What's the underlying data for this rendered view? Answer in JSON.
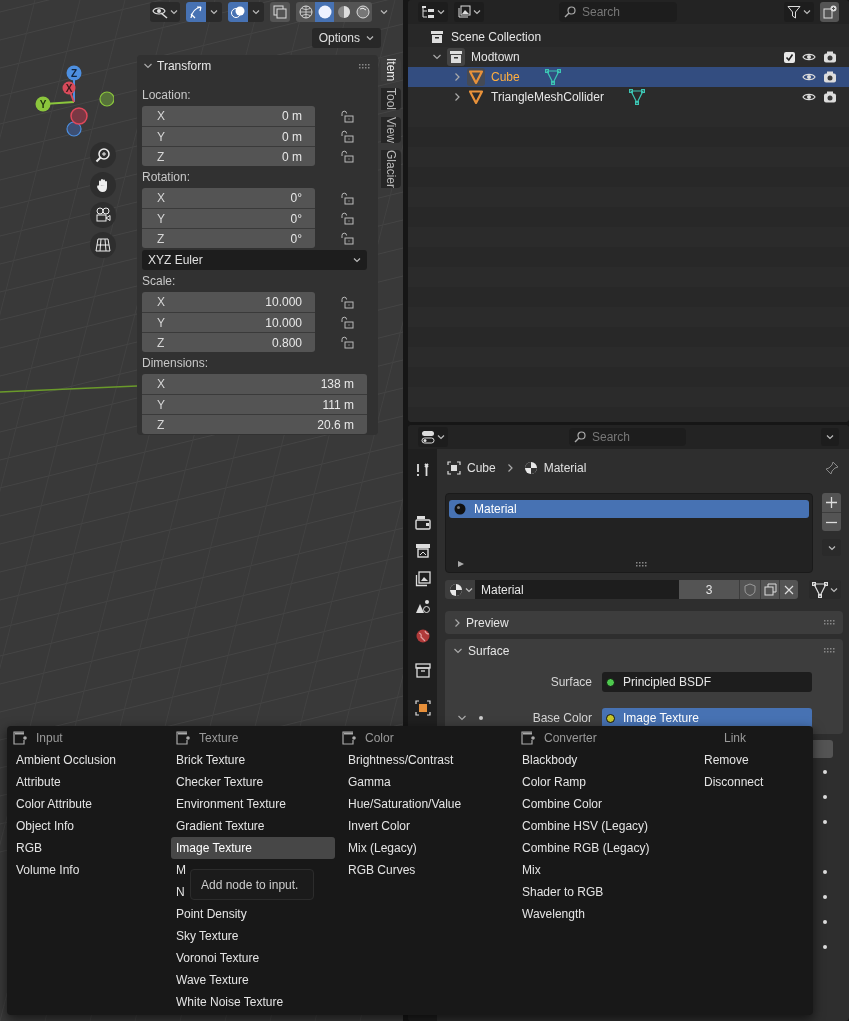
{
  "viewport": {
    "header": {
      "gizmos": true,
      "overlays": true,
      "xray": false,
      "shading": [
        {
          "kind": "wireframe",
          "selected": false
        },
        {
          "kind": "solid",
          "selected": true
        },
        {
          "kind": "material",
          "selected": false
        },
        {
          "kind": "rendered",
          "selected": false
        }
      ]
    },
    "options_button": "Options",
    "gizmo_axes": [
      "X",
      "Y",
      "Z"
    ],
    "sidebar": {
      "title": "Transform",
      "expanded": true,
      "groups": [
        {
          "kind": "vector",
          "label": "Location:",
          "lockable": true,
          "rows": [
            {
              "axis": "X",
              "value": "0 m"
            },
            {
              "axis": "Y",
              "value": "0 m"
            },
            {
              "axis": "Z",
              "value": "0 m"
            }
          ]
        },
        {
          "kind": "vector",
          "label": "Rotation:",
          "lockable": true,
          "rows": [
            {
              "axis": "X",
              "value": "0°"
            },
            {
              "axis": "Y",
              "value": "0°"
            },
            {
              "axis": "Z",
              "value": "0°"
            }
          ]
        },
        {
          "kind": "dropdown",
          "value": "XYZ Euler"
        },
        {
          "kind": "vector",
          "label": "Scale:",
          "lockable": true,
          "rows": [
            {
              "axis": "X",
              "value": "10.000"
            },
            {
              "axis": "Y",
              "value": "10.000"
            },
            {
              "axis": "Z",
              "value": "0.800"
            }
          ]
        },
        {
          "kind": "vector",
          "label": "Dimensions:",
          "lockable": false,
          "rows": [
            {
              "axis": "X",
              "value": "138 m"
            },
            {
              "axis": "Y",
              "value": "111 m"
            },
            {
              "axis": "Z",
              "value": "20.6 m"
            }
          ]
        }
      ]
    },
    "tabs": [
      {
        "label": "Item",
        "selected": true
      },
      {
        "label": "Tool",
        "selected": false
      },
      {
        "label": "View",
        "selected": false
      },
      {
        "label": "Glacier",
        "selected": false
      }
    ]
  },
  "outliner": {
    "search": {
      "placeholder": "Search"
    },
    "tree": [
      {
        "label": "Scene Collection",
        "kind": "scene",
        "selected": false,
        "children": [
          {
            "label": "Modtown",
            "kind": "collection",
            "expanded": true,
            "checked": true,
            "selected": false,
            "children": [
              {
                "label": "Cube",
                "kind": "object",
                "expanded": false,
                "selected": true
              },
              {
                "label": "TriangleMeshCollider",
                "kind": "object",
                "expanded": false,
                "selected": false
              }
            ]
          }
        ]
      }
    ]
  },
  "properties": {
    "search": {
      "placeholder": "Search"
    },
    "breadcrumb": [
      {
        "label": "Cube",
        "kind": "object"
      },
      {
        "label": "Material",
        "kind": "material"
      }
    ],
    "slots": [
      {
        "name": "Material",
        "selected": true
      }
    ],
    "material": {
      "name": "Material",
      "users": "3"
    },
    "panels": [
      {
        "title": "Preview",
        "expanded": false
      },
      {
        "title": "Surface",
        "expanded": true,
        "rows": [
          {
            "kind": "shader",
            "label": "Surface",
            "value": "Principled BSDF",
            "color": "#4ec94e",
            "selected": false
          },
          {
            "kind": "input",
            "label": "Base Color",
            "value": "Image Texture",
            "color": "#c7c72a",
            "selected": true,
            "expanded": true
          }
        ]
      }
    ]
  },
  "menu": {
    "columns": [
      {
        "kind": "category",
        "title": "Input",
        "items": [
          {
            "label": "Ambient Occlusion",
            "selected": false
          },
          {
            "label": "Attribute",
            "selected": false
          },
          {
            "label": "Color Attribute",
            "selected": false
          },
          {
            "label": "Object Info",
            "selected": false
          },
          {
            "label": "RGB",
            "selected": false
          },
          {
            "label": "Volume Info",
            "selected": false
          }
        ]
      },
      {
        "kind": "category",
        "title": "Texture",
        "items": [
          {
            "label": "Brick Texture",
            "selected": false
          },
          {
            "label": "Checker Texture",
            "selected": false
          },
          {
            "label": "Environment Texture",
            "selected": false
          },
          {
            "label": "Gradient Texture",
            "selected": false
          },
          {
            "label": "Image Texture",
            "selected": true
          },
          {
            "label": "M",
            "selected": false
          },
          {
            "label": "N",
            "selected": false
          },
          {
            "label": "Point Density",
            "selected": false
          },
          {
            "label": "Sky Texture",
            "selected": false
          },
          {
            "label": "Voronoi Texture",
            "selected": false
          },
          {
            "label": "Wave Texture",
            "selected": false
          },
          {
            "label": "White Noise Texture",
            "selected": false
          }
        ]
      },
      {
        "kind": "category",
        "title": "Color",
        "items": [
          {
            "label": "Brightness/Contrast",
            "selected": false
          },
          {
            "label": "Gamma",
            "selected": false
          },
          {
            "label": "Hue/Saturation/Value",
            "selected": false
          },
          {
            "label": "Invert Color",
            "selected": false
          },
          {
            "label": "Mix (Legacy)",
            "selected": false
          },
          {
            "label": "RGB Curves",
            "selected": false
          }
        ]
      },
      {
        "kind": "category",
        "title": "Converter",
        "items": [
          {
            "label": "Blackbody",
            "selected": false
          },
          {
            "label": "Color Ramp",
            "selected": false
          },
          {
            "label": "Combine Color",
            "selected": false
          },
          {
            "label": "Combine HSV (Legacy)",
            "selected": false
          },
          {
            "label": "Combine RGB (Legacy)",
            "selected": false
          },
          {
            "label": "Mix",
            "selected": false
          },
          {
            "label": "Shader to RGB",
            "selected": false
          },
          {
            "label": "Wavelength",
            "selected": false
          }
        ]
      },
      {
        "kind": "operations",
        "title": "Link",
        "items": [
          {
            "label": "Remove",
            "selected": false
          },
          {
            "label": "Disconnect",
            "selected": false
          }
        ]
      }
    ],
    "tooltip": "Add node to input."
  }
}
